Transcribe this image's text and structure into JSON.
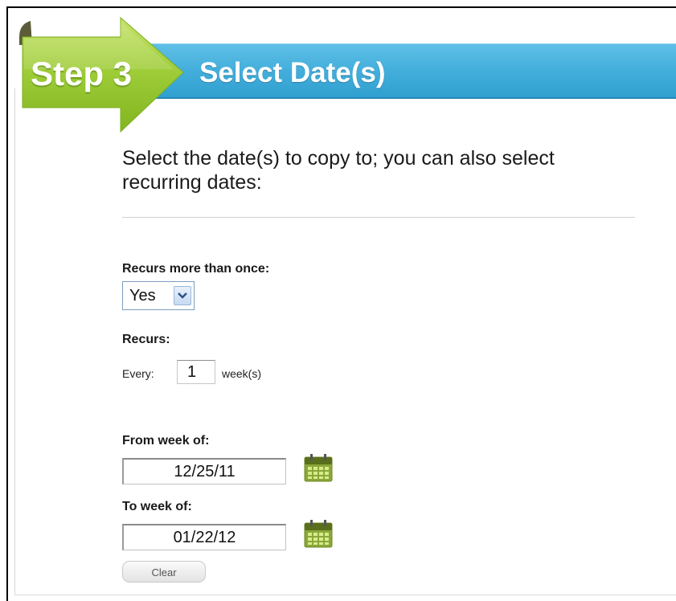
{
  "header": {
    "step_label": "Step 3",
    "title": "Select Date(s)"
  },
  "instructions": "Select the date(s) to copy to; you can also select recurring dates:",
  "recurs_more": {
    "label": "Recurs more than once:",
    "selected": "Yes"
  },
  "recurs": {
    "label": "Recurs:",
    "every_label": "Every:",
    "interval_value": "1",
    "unit_label": "week(s)"
  },
  "from": {
    "label": "From week of:",
    "value": "12/25/11"
  },
  "to": {
    "label": "To week of:",
    "value": "01/22/12"
  },
  "clear_label": "Clear",
  "icons": {
    "calendar": "calendar-icon",
    "dropdown": "chevron-down-icon"
  },
  "colors": {
    "banner_blue": "#43aedb",
    "step_green": "#8fc02c",
    "calendar_green": "#9aba3c"
  }
}
